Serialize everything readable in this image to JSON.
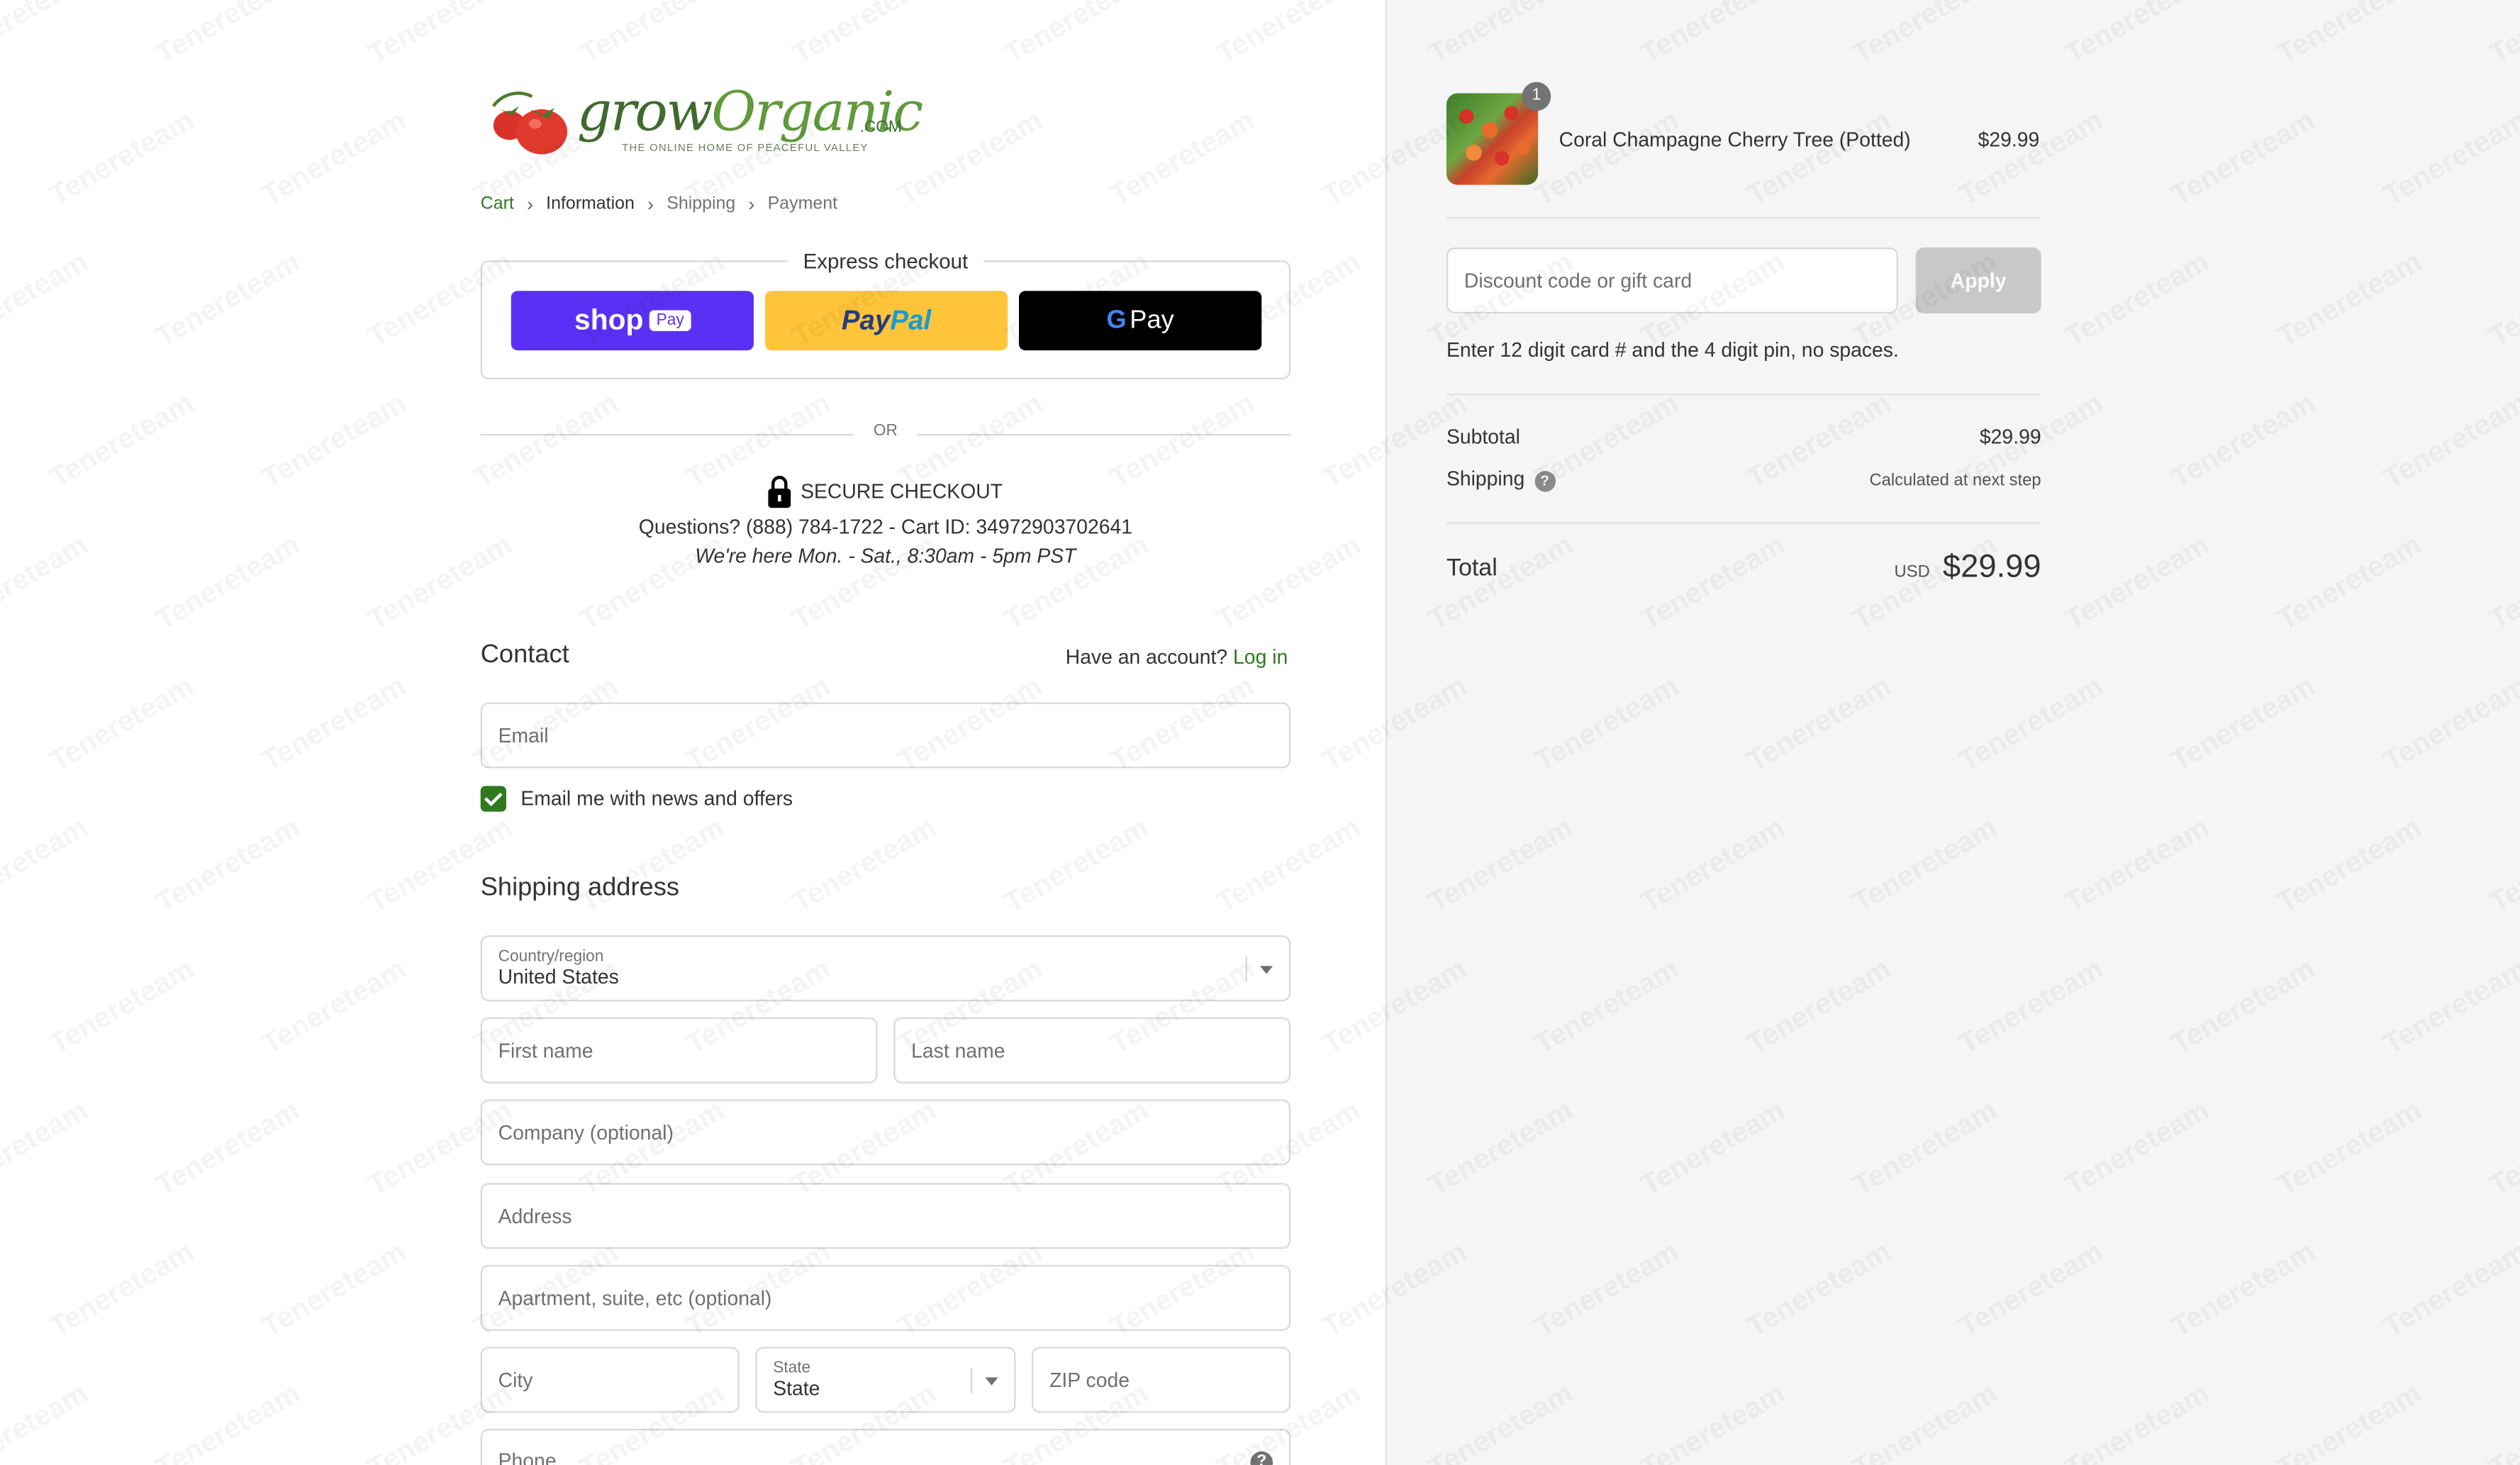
{
  "brand": {
    "logo_grow": "grow",
    "logo_organic": "Organic",
    "logo_com": ".COM",
    "logo_tagline": "THE ONLINE HOME OF PEACEFUL VALLEY"
  },
  "breadcrumb": [
    {
      "label": "Cart"
    },
    {
      "label": "Information"
    },
    {
      "label": "Shipping"
    },
    {
      "label": "Payment"
    }
  ],
  "express": {
    "title": "Express checkout",
    "shop_label": "shop",
    "shop_pay": "Pay",
    "paypal_p1": "Pay",
    "paypal_p2": "Pal",
    "gpay_g": "G",
    "gpay_label": "Pay"
  },
  "divider_or": "OR",
  "secure": {
    "title": "SECURE CHECKOUT",
    "questions": "Questions? (888) 784-1722 - Cart ID: 34972903702641",
    "hours": "We're here Mon. - Sat., 8:30am - 5pm PST"
  },
  "contact": {
    "heading": "Contact",
    "account_prompt": "Have an account?",
    "login_label": "Log in",
    "email_placeholder": "Email",
    "newsletter_label": "Email me with news and offers"
  },
  "shipping": {
    "heading": "Shipping address",
    "country_label": "Country/region",
    "country_value": "United States",
    "first_name": "First name",
    "last_name": "Last name",
    "company": "Company (optional)",
    "address": "Address",
    "apartment": "Apartment, suite, etc (optional)",
    "city": "City",
    "state_label": "State",
    "state_value": "State",
    "zip": "ZIP code",
    "phone": "Phone"
  },
  "order": {
    "qty_badge": "1",
    "product_name": "Coral Champagne Cherry Tree (Potted)",
    "product_price": "$29.99",
    "discount_placeholder": "Discount code or gift card",
    "apply_label": "Apply",
    "gift_hint": "Enter 12 digit card # and the 4 digit pin, no spaces.",
    "subtotal_label": "Subtotal",
    "subtotal_value": "$29.99",
    "shipping_label": "Shipping",
    "shipping_value": "Calculated at next step",
    "total_label": "Total",
    "currency": "USD",
    "total_value": "$29.99"
  },
  "watermark": "Tenereteam",
  "colors": {
    "accent_green": "#2f7a1f",
    "shop_pay": "#5a31f4",
    "paypal": "#ffc439"
  }
}
